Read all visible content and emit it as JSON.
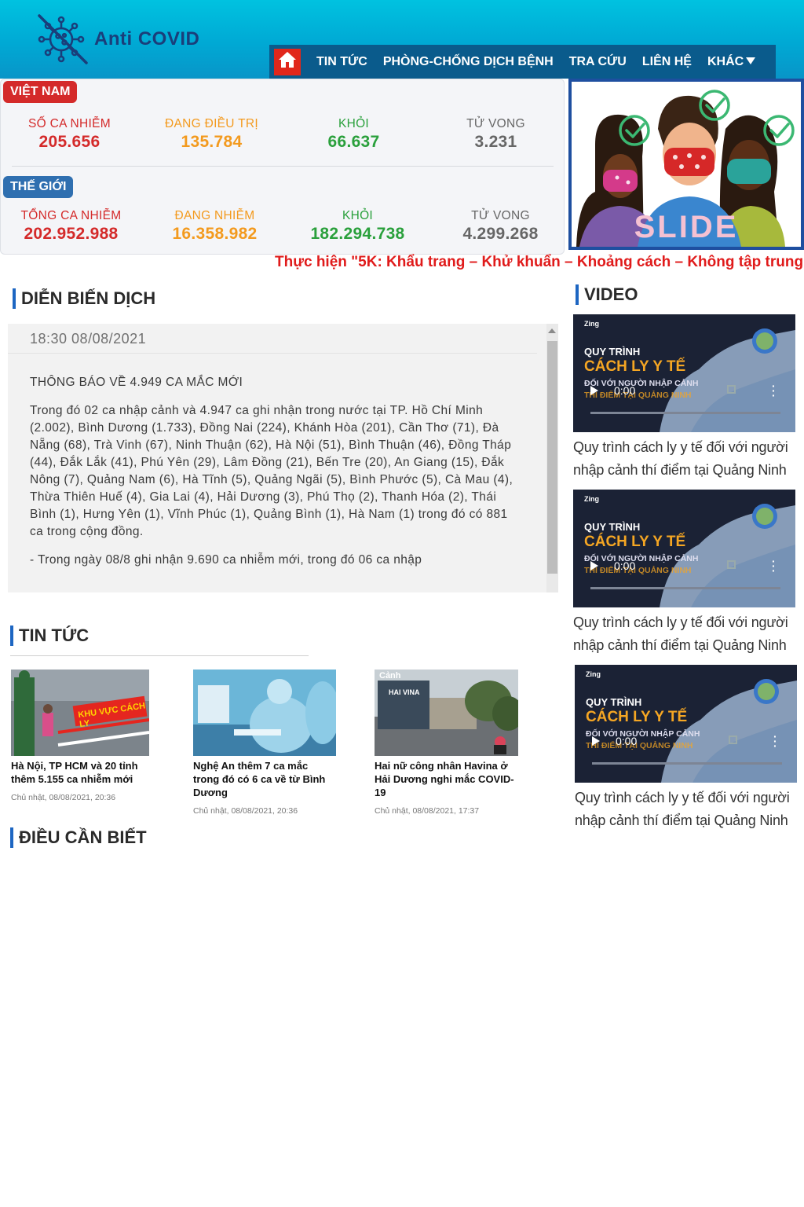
{
  "brand": {
    "name": "Anti COVID"
  },
  "nav": {
    "items": [
      {
        "label": "TIN TỨC"
      },
      {
        "label": "PHÒNG-CHỐNG DỊCH BỆNH"
      },
      {
        "label": "TRA CỨU"
      },
      {
        "label": "LIÊN HỆ"
      },
      {
        "label": "KHÁC"
      }
    ]
  },
  "vietnam": {
    "label": "VIỆT NAM",
    "stats": [
      {
        "label": "SỐ CA NHIỄM",
        "value": "205.656",
        "color": "#d42a2a"
      },
      {
        "label": "ĐANG ĐIỀU TRỊ",
        "value": "135.784",
        "color": "#f39a1e"
      },
      {
        "label": "KHỎI",
        "value": "66.637",
        "color": "#2aa03c"
      },
      {
        "label": "TỬ VONG",
        "value": "3.231",
        "color": "#666666"
      }
    ]
  },
  "world": {
    "label": "THẾ GIỚI",
    "stats": [
      {
        "label": "TỔNG CA NHIỄM",
        "value": "202.952.988",
        "color": "#d42a2a"
      },
      {
        "label": "ĐANG NHIỄM",
        "value": "16.358.982",
        "color": "#f39a1e"
      },
      {
        "label": "KHỎI",
        "value": "182.294.738",
        "color": "#2aa03c"
      },
      {
        "label": "TỬ VONG",
        "value": "4.299.268",
        "color": "#666666"
      }
    ]
  },
  "slide": {
    "label": "SLIDE"
  },
  "marquee": {
    "text": "Thực hiện \"5K: Khẩu trang – Khử khuẩn – Khoảng cách – Không tập trung"
  },
  "sections": {
    "dien_bien": "DIỄN BIẾN DỊCH",
    "video": "VIDEO",
    "tin_tuc": "TIN TỨC",
    "dieu_can_biet": "ĐIỀU CẦN BIẾT"
  },
  "feed": {
    "date": "18:30 08/08/2021",
    "heading": "THÔNG BÁO VỀ 4.949 CA MẮC MỚI",
    "body": "Trong đó 02 ca nhập cảnh và 4.947 ca ghi nhận trong nước tại TP. Hồ Chí Minh (2.002), Bình Dương (1.733), Đồng Nai (224), Khánh Hòa (201), Cần Thơ (71), Đà Nẵng (68), Trà Vinh (67), Ninh Thuận (62), Hà Nội (51), Bình Thuận (46), Đồng Tháp (44), Đắk Lắk (41), Phú Yên (29), Lâm Đồng (21), Bến Tre (20), An Giang (15), Đắk Nông (7), Quảng Nam (6), Hà Tĩnh (5), Quảng Ngãi (5), Bình Phước (5), Cà Mau (4), Thừa Thiên Huế (4), Gia Lai (4), Hải Dương (3), Phú Thọ (2), Thanh Hóa (2), Thái Bình (1), Hưng Yên (1), Vĩnh Phúc (1), Quảng Bình (1), Hà Nam (1) trong đó có 881 ca trong cộng đồng.",
    "more": "- Trong ngày 08/8 ghi nhận 9.690 ca nhiễm mới, trong đó 06 ca nhập"
  },
  "news": [
    {
      "title": "Hà Nội, TP HCM và 20 tỉnh thêm 5.155 ca nhiễm mới",
      "date": "Chủ nhật, 08/08/2021, 20:36",
      "sign": "KHU VỰC CÁCH LY"
    },
    {
      "title": "Nghệ An thêm 7 ca mắc trong đó có 6 ca về từ Bình Dương",
      "date": "Chủ nhật, 08/08/2021, 20:36"
    },
    {
      "title": "Hai nữ công nhân Havina ở Hải Dương nghi mắc COVID-19",
      "date": "Chủ nhật, 08/08/2021, 17:37",
      "sign": "HAI VINA",
      "watermark": "Cảnh"
    }
  ],
  "videos": [
    {
      "title": "Quy trình cách ly y tế đối với người nhập cảnh thí điểm tại Quảng Ninh",
      "zing": "Zing",
      "line1": "QUY TRÌNH",
      "line2": "CÁCH LY Y TẾ",
      "line3": "ĐỐI VỚI NGƯỜI NHẬP CẢNH",
      "line4": "THÍ ĐIỂM TẠI QUẢNG NINH",
      "time": "0:00"
    },
    {
      "title": "Quy trình cách ly y tế đối với người nhập cảnh thí điểm tại Quảng Ninh",
      "zing": "Zing",
      "line1": "QUY TRÌNH",
      "line2": "CÁCH LY Y TẾ",
      "line3": "ĐỐI VỚI NGƯỜI NHẬP CẢNH",
      "line4": "THÍ ĐIỂM TẠI QUẢNG NINH",
      "time": "0:00"
    },
    {
      "title": "Quy trình cách ly y tế đối với người nhập cảnh thí điểm tại Quảng Ninh",
      "zing": "Zing",
      "line1": "QUY TRÌNH",
      "line2": "CÁCH LY Y TẾ",
      "line3": "ĐỐI VỚI NGƯỜI NHẬP CẢNH",
      "line4": "THÍ ĐIỂM TẠI QUẢNG NINH",
      "time": "0:00"
    }
  ]
}
